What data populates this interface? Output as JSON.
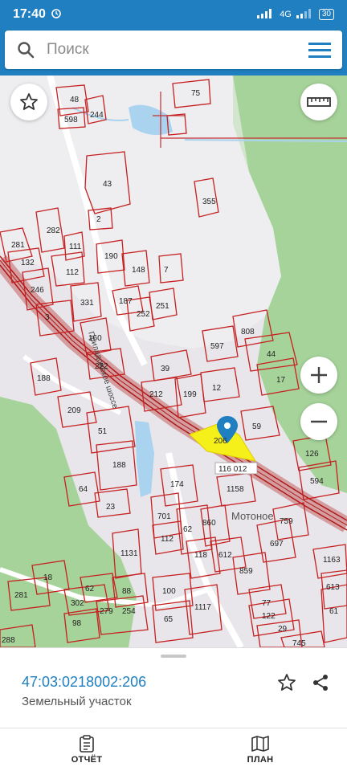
{
  "status_bar": {
    "time": "17:40",
    "network": "4G",
    "battery": "30"
  },
  "search": {
    "placeholder": "Поиск"
  },
  "map": {
    "road_label": "Приладожское шоссе",
    "place_label": "Мотоное",
    "selected_plot_id": "206",
    "quarter_label": "116 012",
    "plot_numbers": [
      "48",
      "598",
      "244",
      "75",
      "43",
      "355",
      "2",
      "281",
      "282",
      "132",
      "111",
      "246",
      "112",
      "190",
      "148",
      "7",
      "3",
      "331",
      "187",
      "252",
      "251",
      "160",
      "222",
      "188",
      "597",
      "808",
      "44",
      "17",
      "39",
      "212",
      "12",
      "199",
      "209",
      "51",
      "188",
      "64",
      "23",
      "59",
      "126",
      "594",
      "174",
      "1158",
      "701",
      "112",
      "62",
      "860",
      "697",
      "759",
      "1131",
      "18",
      "118",
      "612",
      "859",
      "1163",
      "613",
      "281",
      "302",
      "62",
      "88",
      "100",
      "77",
      "98",
      "279",
      "254",
      "1117",
      "122",
      "61",
      "65",
      "29",
      "288",
      "745"
    ]
  },
  "selection": {
    "cadastral_number": "47:03:0218002:206",
    "object_type": "Земельный участок"
  },
  "bottom_nav": [
    {
      "label": "ОТЧЁТ",
      "icon": "report-icon"
    },
    {
      "label": "ПЛАН",
      "icon": "map-plan-icon"
    }
  ]
}
